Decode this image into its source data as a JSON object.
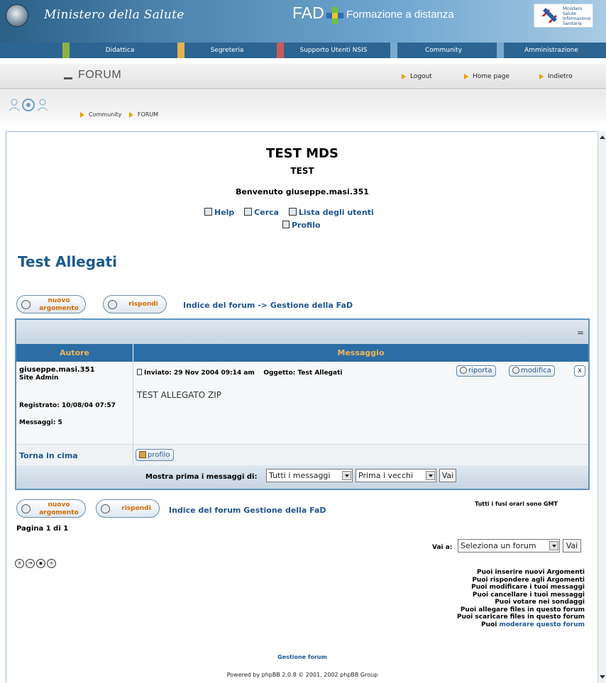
{
  "header": {
    "ministry": "Ministero della Salute",
    "fad": "FAD",
    "fad_sub": "Formazione a distanza",
    "right_logo_text": [
      "Ministero",
      "Salute",
      "Informazione",
      "Sanitaria"
    ]
  },
  "nav": [
    "Didattica",
    "Segreteria",
    "Supporto Utenti NSIS",
    "Community",
    "Amministrazione"
  ],
  "nav_colors": [
    "#8bb24a",
    "#e5b24a",
    "#c85a5a",
    "#7aa9cf",
    "#7aa9cf"
  ],
  "forum_bar": {
    "title": "FORUM",
    "links": [
      "Logout",
      "Home page",
      "Indietro"
    ]
  },
  "breadcrumb": [
    "Community",
    "FORUM"
  ],
  "site": {
    "title": "TEST MDS",
    "subtitle": "TEST",
    "welcome": "Benvenuto giuseppe.masi.351",
    "links": [
      "Help",
      "Cerca",
      "Lista degli utenti"
    ],
    "profile": "Profilo"
  },
  "topic": {
    "title": "Test Allegati",
    "new_topic_top": "nuovo",
    "new_topic_bottom": "argomento",
    "reply": "rispondi",
    "nav_top": "Indice del forum -> Gestione della FaD",
    "nav_bottom": "Indice del forum Gestione della FaD"
  },
  "table": {
    "eq": "=",
    "col_author": "Autore",
    "col_message": "Messaggio",
    "post": {
      "author": "giuseppe.masi.351",
      "rank": "Site Admin",
      "registered": "Registrato: 10/08/04 07:57",
      "messages": "Messaggi: 5",
      "header": "Inviato: 29 Nov 2004 09:14 am    Oggetto: Test Allegati",
      "body": "TEST ALLEGATO ZIP",
      "quote": "riporta",
      "edit": "modifica",
      "delete": "x"
    },
    "back_to_top": "Torna in cima",
    "profile_btn": "profilo",
    "show_label": "Mostra prima i messaggi di:",
    "show_value": "Tutti i messaggi",
    "order_value": "Prima i vecchi",
    "go": "Vai"
  },
  "timezone": "Tutti i fusi orari sono GMT",
  "pager": "Pagina 1 di 1",
  "jump": {
    "label": "Vai a:",
    "value": "Seleziona un forum",
    "go": "Vai"
  },
  "permissions": [
    "Puoi inserire nuovi Argomenti",
    "Puoi rispondere agli Argomenti",
    "Puoi modificare i tuoi messaggi",
    "Puoi cancellare i tuoi messaggi",
    "Puoi votare nei sondaggi",
    "Puoi allegare files in questo forum",
    "Puoi scaricare files in questo forum"
  ],
  "permissions_last_prefix": "Puoi",
  "permissions_last_link": "moderare questo forum",
  "manage_forum": "Gestione forum",
  "powered_by": "Powered by phpBB 2.0.8 © 2001, 2002 phpBB Group"
}
